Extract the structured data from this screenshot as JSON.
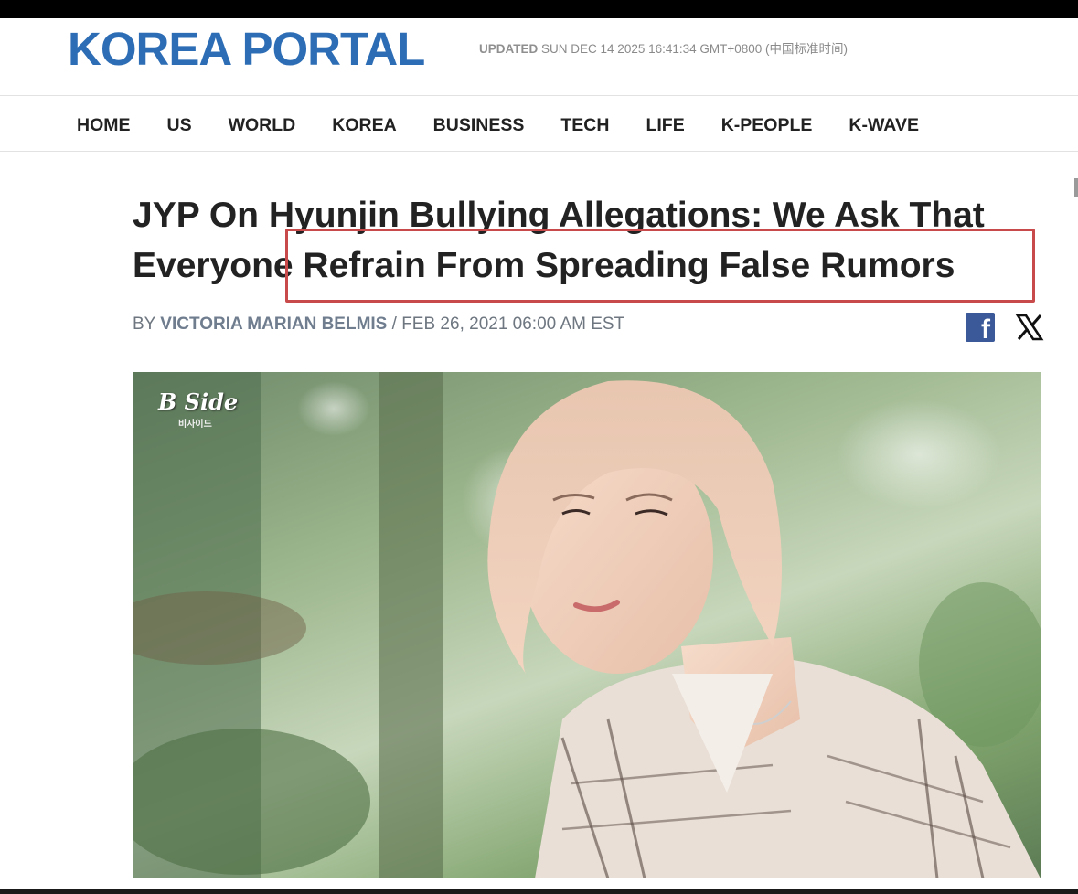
{
  "header": {
    "logo": "KOREA PORTAL",
    "updated_label": "UPDATED",
    "updated_time": "SUN DEC 14 2025 16:41:34 GMT+0800 (中国标准时间)"
  },
  "nav": {
    "items": [
      "HOME",
      "US",
      "WORLD",
      "KOREA",
      "BUSINESS",
      "TECH",
      "LIFE",
      "K-PEOPLE",
      "K-WAVE"
    ]
  },
  "article": {
    "headline_line1": "JYP On Hyunjin Bullying Allegations: We Ask That",
    "headline_line2": "Everyone Refrain From Spreading False Rumors",
    "byline_prefix": "BY",
    "author": "VICTORIA MARIAN BELMIS",
    "separator": "/",
    "date": "FEB 26, 2021 06:00 AM EST"
  },
  "share": {
    "facebook_icon": "facebook-icon",
    "x_icon": "x-icon",
    "facebook_color": "#3b5998"
  },
  "image": {
    "watermark": "B Side",
    "watermark_sub": "비사이드"
  },
  "colors": {
    "brand": "#2d6db5",
    "highlight": "#c94a4a"
  }
}
